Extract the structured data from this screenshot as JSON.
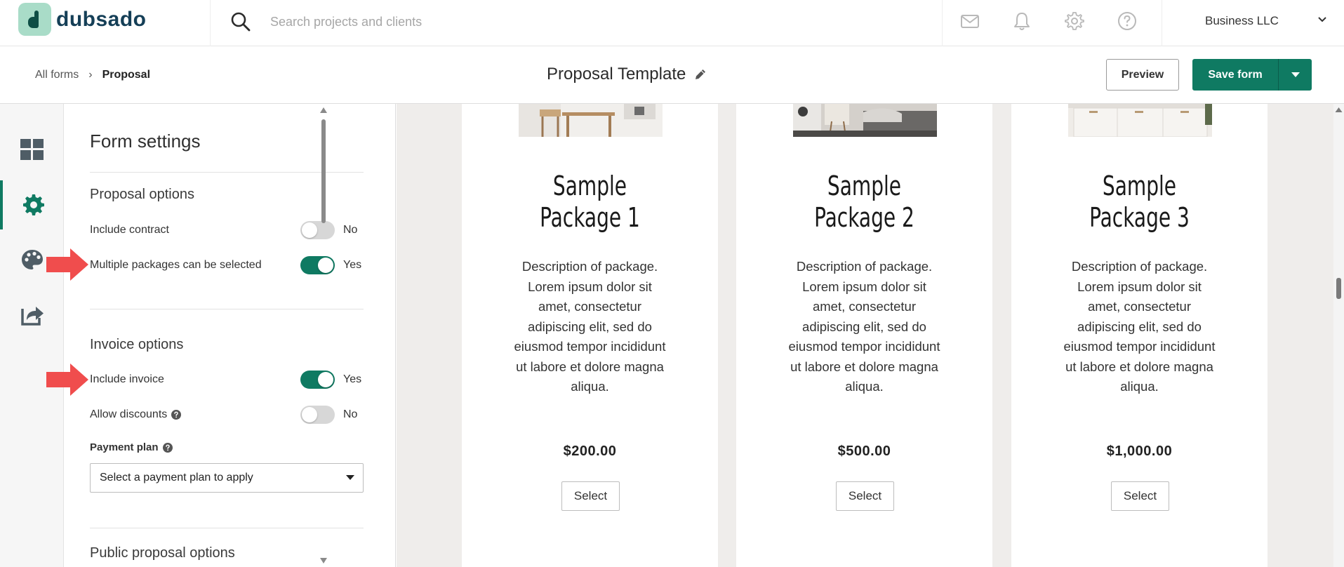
{
  "brand": {
    "name": "dubsado",
    "logo_color": "#a9dcc8",
    "logo_ink": "#0e4e45",
    "accent": "#0f7a62"
  },
  "search": {
    "placeholder": "Search projects and clients"
  },
  "top_icons": [
    "mail-icon",
    "bell-icon",
    "gear-icon",
    "help-circle-icon"
  ],
  "account": {
    "name": "Business LLC"
  },
  "breadcrumb": {
    "parent": "All forms",
    "separator": "›",
    "current": "Proposal"
  },
  "form": {
    "title": "Proposal Template"
  },
  "actions": {
    "preview": "Preview",
    "save": "Save form"
  },
  "rail": [
    {
      "icon": "dashboard-grid-icon",
      "active": false
    },
    {
      "icon": "gear-icon",
      "active": true
    },
    {
      "icon": "palette-icon",
      "active": false
    },
    {
      "icon": "share-icon",
      "active": false
    }
  ],
  "settings": {
    "title": "Form settings",
    "proposal": {
      "title": "Proposal options",
      "include_contract": {
        "label": "Include contract",
        "on": false,
        "state": "No"
      },
      "multiple_packages": {
        "label": "Multiple packages can be selected",
        "on": true,
        "state": "Yes"
      }
    },
    "invoice": {
      "title": "Invoice options",
      "include_invoice": {
        "label": "Include invoice",
        "on": true,
        "state": "Yes"
      },
      "allow_discounts": {
        "label": "Allow discounts",
        "on": false,
        "state": "No"
      },
      "payment_plan": {
        "label": "Payment plan",
        "value": "Select a payment plan to apply"
      }
    },
    "public": {
      "title": "Public proposal options"
    }
  },
  "packages": [
    {
      "name_line1": "Sample",
      "name_line2": "Package 1",
      "description": "Description of package. Lorem ipsum dolor sit amet, consectetur adipiscing elit, sed do eiusmod tempor incididunt ut labore et dolore magna aliqua.",
      "price": "$200.00",
      "button": "Select"
    },
    {
      "name_line1": "Sample",
      "name_line2": "Package 2",
      "description": "Description of package. Lorem ipsum dolor sit amet, consectetur adipiscing elit, sed do eiusmod tempor incididunt ut labore et dolore magna aliqua.",
      "price": "$500.00",
      "button": "Select"
    },
    {
      "name_line1": "Sample",
      "name_line2": "Package 3",
      "description": "Description of package. Lorem ipsum dolor sit amet, consectetur adipiscing elit, sed do eiusmod tempor incididunt ut labore et dolore magna aliqua.",
      "price": "$1,000.00",
      "button": "Select"
    }
  ],
  "annotation_color": "#f04d4d"
}
